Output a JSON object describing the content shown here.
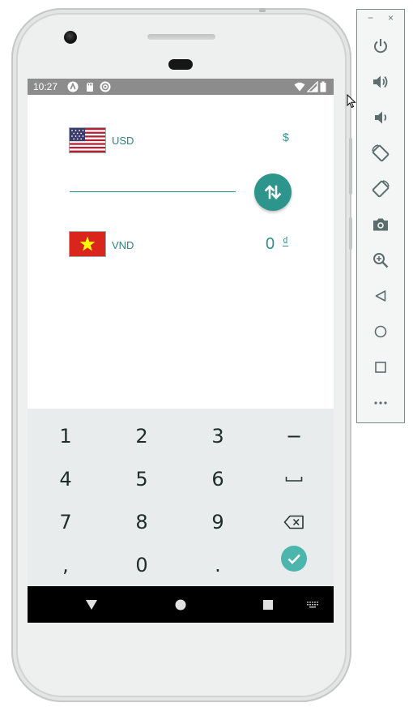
{
  "status_bar": {
    "time": "10:27",
    "notification_icons": [
      "android-icon",
      "sd-card-icon",
      "sync-icon"
    ],
    "system_icons": [
      "wifi-icon",
      "signal-icon",
      "battery-icon"
    ]
  },
  "converter": {
    "from": {
      "code": "USD",
      "symbol": "$",
      "flag": "us-flag"
    },
    "amount_input": {
      "value": "",
      "placeholder": ""
    },
    "swap_icon": "swap-vertical-icon",
    "to": {
      "code": "VND",
      "symbol": "₫",
      "flag": "vn-flag",
      "value": "0"
    }
  },
  "keyboard": {
    "rows": [
      [
        "1",
        "2",
        "3",
        "−"
      ],
      [
        "4",
        "5",
        "6",
        "space"
      ],
      [
        "7",
        "8",
        "9",
        "backspace"
      ],
      [
        ",",
        "0",
        ".",
        "done"
      ]
    ]
  },
  "nav_bar": [
    "back-icon",
    "home-icon",
    "recents-icon",
    "keyboard-switch-icon"
  ],
  "emulator_toolbar": {
    "window_controls": [
      "−",
      "×"
    ],
    "buttons": [
      "power",
      "volume-up",
      "volume-down",
      "rotate-left",
      "rotate-right",
      "screenshot",
      "zoom",
      "back",
      "home",
      "overview",
      "more"
    ]
  },
  "colors": {
    "accent": "#2e958c",
    "status_bar": "#8c8c8c",
    "keyboard_bg": "#e8ecec",
    "done_key": "#4db6ac"
  }
}
